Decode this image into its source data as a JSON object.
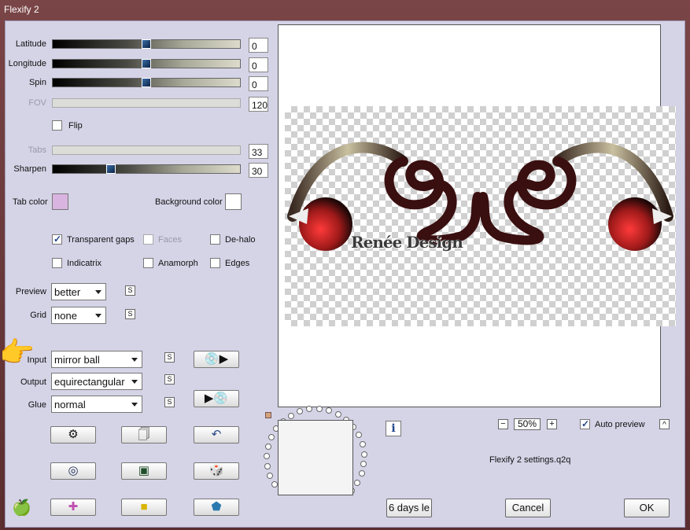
{
  "window": {
    "title": "Flexify 2"
  },
  "sliders": {
    "latitude": {
      "label": "Latitude",
      "value": "0",
      "level": 0.5
    },
    "longitude": {
      "label": "Longitude",
      "value": "0",
      "level": 0.5
    },
    "spin": {
      "label": "Spin",
      "value": "0",
      "level": 0.5
    },
    "fov": {
      "label": "FOV",
      "value": "120",
      "level": 0.0
    },
    "tabs": {
      "label": "Tabs",
      "value": "33",
      "level": 0.0
    },
    "sharpen": {
      "label": "Sharpen",
      "value": "30",
      "level": 0.3
    }
  },
  "checkboxes": {
    "flip": {
      "label": "Flip",
      "checked": false
    },
    "transparent_gaps": {
      "label": "Transparent gaps",
      "checked": true
    },
    "faces": {
      "label": "Faces",
      "checked": false
    },
    "de_halo": {
      "label": "De-halo",
      "checked": false
    },
    "indicatrix": {
      "label": "Indicatrix",
      "checked": false
    },
    "anamorph": {
      "label": "Anamorph",
      "checked": false
    },
    "edges": {
      "label": "Edges",
      "checked": false
    }
  },
  "colors": {
    "tab_color_label": "Tab color",
    "tab_color": "#d9b4e0",
    "background_color_label": "Background color",
    "background_color": "#ffffff"
  },
  "selects": {
    "preview": {
      "label": "Preview",
      "value": "better"
    },
    "grid": {
      "label": "Grid",
      "value": "none"
    },
    "input": {
      "label": "Input",
      "value": "mirror ball"
    },
    "output": {
      "label": "Output",
      "value": "equirectangular"
    },
    "glue": {
      "label": "Glue",
      "value": "normal"
    }
  },
  "s_button": "S",
  "preview_watermark": "Renée Design",
  "zoom": {
    "minus": "−",
    "value": "50%",
    "plus": "+"
  },
  "auto_preview": {
    "label": "Auto preview",
    "checked": true,
    "chevron": "^"
  },
  "info_icon": "i",
  "settings_file": "Flexify 2 settings.q2q",
  "buttons": {
    "trial": "6 days le",
    "cancel": "Cancel",
    "ok": "OK"
  }
}
